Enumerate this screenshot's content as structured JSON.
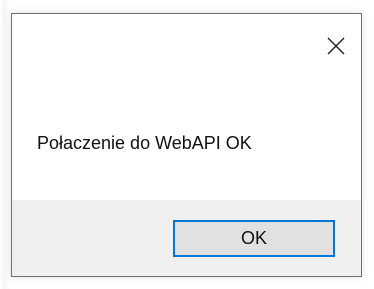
{
  "dialog": {
    "message": "Połaczenie do WebAPI OK",
    "ok_label": "OK",
    "close_icon": "close-icon"
  },
  "colors": {
    "footer_bg": "#f0f0f0",
    "button_border": "#0078d7",
    "button_bg": "#e1e1e1",
    "dialog_border": "#6f6f6f"
  }
}
